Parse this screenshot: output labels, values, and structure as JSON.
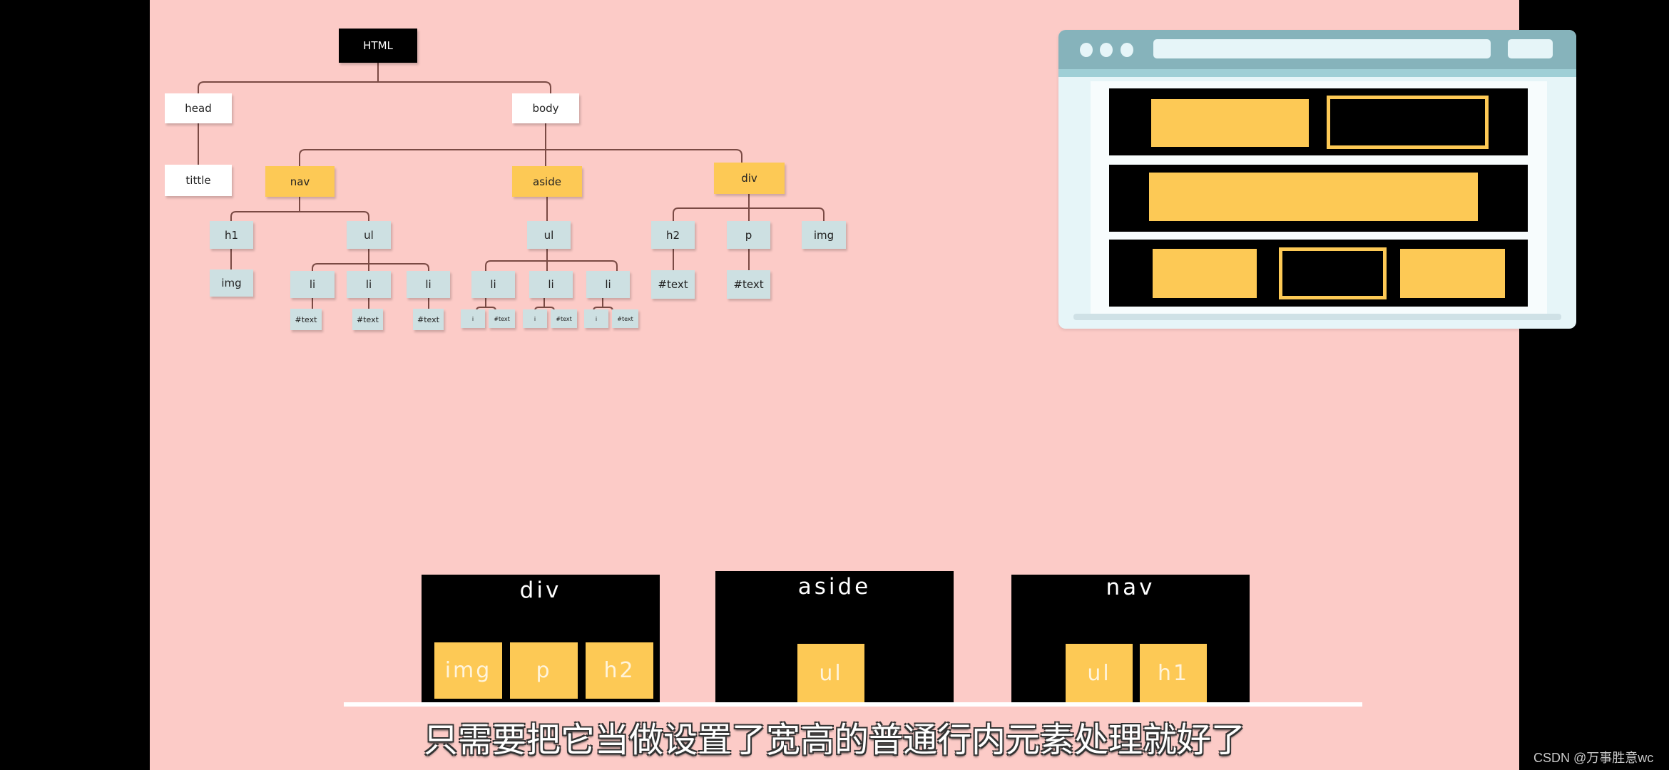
{
  "tree": {
    "root": "HTML",
    "head": "head",
    "title": "tittle",
    "body": "body",
    "nav": "nav",
    "aside": "aside",
    "div": "div",
    "nav_children": [
      "h1",
      "ul"
    ],
    "nav_h1_child": "img",
    "nav_li": [
      "li",
      "li",
      "li"
    ],
    "nav_li_text": [
      "#text",
      "#text",
      "#text"
    ],
    "aside_ul": "ul",
    "aside_li": [
      "li",
      "li",
      "li"
    ],
    "aside_li_children": [
      [
        "i",
        "#text"
      ],
      [
        "i",
        "#text"
      ],
      [
        "i",
        "#text"
      ]
    ],
    "div_children": [
      "h2",
      "p",
      "img"
    ],
    "div_text": [
      "#text",
      "#text"
    ]
  },
  "boxes": [
    {
      "label": "div",
      "children": [
        "img",
        "p",
        "h2"
      ]
    },
    {
      "label": "aside",
      "children": [
        "ul"
      ]
    },
    {
      "label": "nav",
      "children": [
        "ul",
        "h1"
      ]
    }
  ],
  "subtitle": "只需要把它当做设置了宽高的普通行内元素处理就好了",
  "watermark": "CSDN @万事胜意wc",
  "colors": {
    "background": "#fccbc7",
    "accent": "#fdc955",
    "node_blue": "#cde0e2",
    "browser_bar": "#86b3bb"
  }
}
